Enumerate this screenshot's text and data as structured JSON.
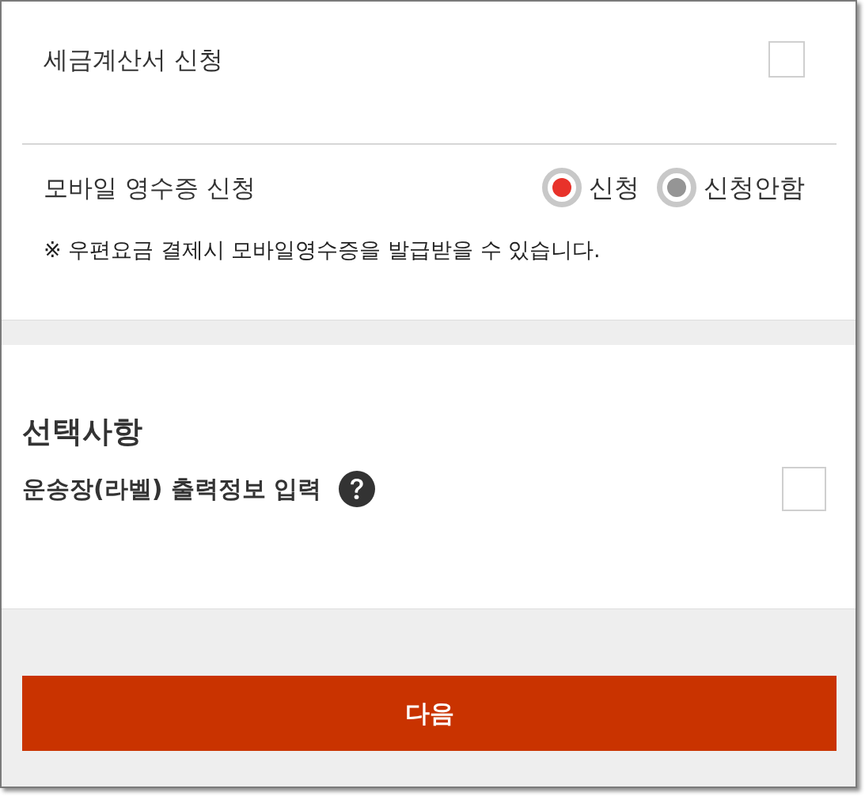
{
  "tax_invoice": {
    "label": "세금계산서 신청",
    "checked": false
  },
  "mobile_receipt": {
    "label": "모바일 영수증 신청",
    "options": [
      {
        "label": "신청",
        "selected": true
      },
      {
        "label": "신청안함",
        "selected": false
      }
    ],
    "note": "※ 우편요금 결제시 모바일영수증을 발급받을 수 있습니다."
  },
  "optional": {
    "title": "선택사항",
    "items": [
      {
        "label": "운송장(라벨) 출력정보 입력",
        "checked": false
      }
    ]
  },
  "next_button": {
    "label": "다음"
  }
}
